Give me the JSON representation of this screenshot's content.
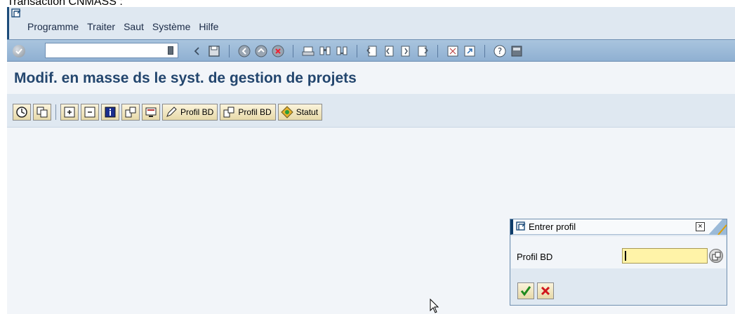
{
  "caption": "Transaction CNMASS :",
  "menubar": {
    "items": [
      {
        "label": "Programme"
      },
      {
        "label": "Traiter"
      },
      {
        "label": "Saut"
      },
      {
        "label": "Système"
      },
      {
        "label": "Hilfe"
      }
    ]
  },
  "standard_toolbar": {
    "command_field_value": "",
    "icons": [
      "enter-icon",
      "back-icon",
      "save-icon",
      "back-green-icon",
      "exit-icon",
      "cancel-icon",
      "print-icon",
      "find-icon",
      "find-next-icon",
      "first-page-icon",
      "prev-page-icon",
      "next-page-icon",
      "last-page-icon",
      "new-session-icon",
      "shortcut-icon",
      "help-icon",
      "layout-icon"
    ]
  },
  "title": "Modif. en masse ds le syst. de gestion de projets",
  "app_toolbar": {
    "buttons": [
      {
        "icon": "execute-icon",
        "label": ""
      },
      {
        "icon": "copy-icon",
        "label": ""
      },
      {
        "icon": "expand-icon",
        "label": ""
      },
      {
        "icon": "collapse-icon",
        "label": ""
      },
      {
        "icon": "info-icon",
        "label": ""
      },
      {
        "icon": "object-icon",
        "label": ""
      },
      {
        "icon": "screen-icon",
        "label": ""
      },
      {
        "icon": "pencil-icon",
        "label": "Profil BD"
      },
      {
        "icon": "object-icon",
        "label": "Profil BD"
      },
      {
        "icon": "status-icon",
        "label": "Statut"
      }
    ]
  },
  "dialog": {
    "title": "Entrer profil",
    "field_label": "Profil BD",
    "field_value": ""
  },
  "colors": {
    "title_text": "#23466e",
    "toolbar_blue": "#9bbad8",
    "field_yellow": "#fff3a8"
  }
}
